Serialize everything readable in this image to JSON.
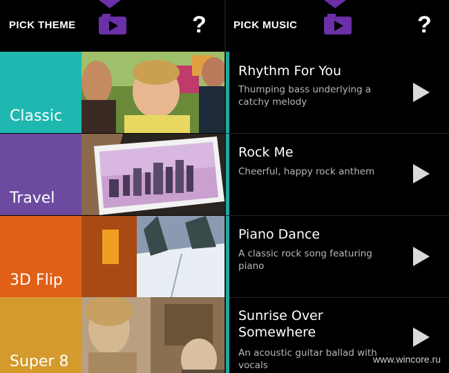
{
  "colors": {
    "accent": "#6b2fa8",
    "teal_bar": "#1fa8a0"
  },
  "left": {
    "title": "PICK THEME",
    "help": "?",
    "themes": [
      {
        "label": "Classic",
        "color": "#1eb8b0",
        "thumb_icon": "family-photo"
      },
      {
        "label": "Travel",
        "color": "#6b4aa0",
        "thumb_icon": "city-skyline-photo"
      },
      {
        "label": "3D Flip",
        "color": "#e06018",
        "thumb_icon": "snowy-landscape-photo"
      },
      {
        "label": "Super 8",
        "color": "#d49a2c",
        "thumb_icon": "vintage-people-photo"
      }
    ]
  },
  "right": {
    "title": "PICK MUSIC",
    "help": "?",
    "tracks": [
      {
        "title": "Rhythm For You",
        "desc": "Thumping bass underlying a catchy melody"
      },
      {
        "title": "Rock Me",
        "desc": "Cheerful, happy rock anthem"
      },
      {
        "title": "Piano Dance",
        "desc": "A classic rock song featuring piano"
      },
      {
        "title": "Sunrise Over Somewhere",
        "desc": "An acoustic guitar ballad with vocals"
      }
    ]
  },
  "watermark": "www.wincore.ru"
}
